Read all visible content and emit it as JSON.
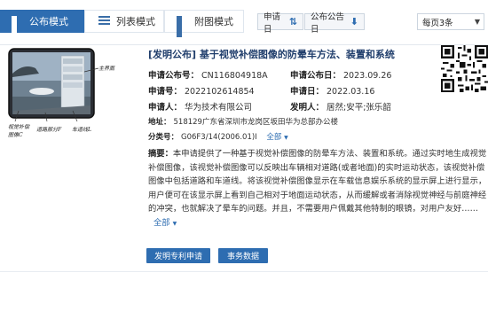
{
  "toolbar": {
    "tabs": [
      {
        "label": "公布模式"
      },
      {
        "label": "列表模式"
      },
      {
        "label": "附图模式"
      }
    ],
    "sort_app_date": "申请日",
    "sort_pub_date": "公布公告日",
    "per_page": "每页3条",
    "colors": {
      "accent": "#2e6db1",
      "title": "#1f3d6b"
    }
  },
  "patent": {
    "title": "[发明公布] 基于视觉补偿图像的防晕车方法、装置和系统",
    "pub_no_label": "申请公布号：",
    "pub_no": "CN116804918A",
    "pub_date_label": "申请公布日：",
    "pub_date": "2023.09.26",
    "app_no_label": "申请号：",
    "app_no": "2022102614854",
    "app_date_label": "申请日：",
    "app_date": "2022.03.16",
    "applicant_label": "申请人：",
    "applicant": "华为技术有限公司",
    "inventor_label": "发明人：",
    "inventor": "居然;安平;张乐韶",
    "address_label": "地址：",
    "address": "518129广东省深圳市龙岗区坂田华为总部办公楼",
    "class_label": "分类号：",
    "class_no": "G06F3/14(2006.01)I",
    "all_label": "全部",
    "abstract_label": "摘要：",
    "abstract": "本申请提供了一种基于视觉补偿图像的防晕车方法、装置和系统。通过实时地生成视觉补偿图像，该视觉补偿图像可以反映出车辆相对道路(或者地面)的实时运动状态，该视觉补偿图像中包括道路和车道线。将该视觉补偿图像显示在车载信息娱乐系统的显示屏上进行显示，用户便可在该显示屏上看到自己相对于地面运动状态，从而缓解或者消除视觉神经与前庭神经的冲突，也就解决了晕车的问题。并且，不需要用户佩戴其他特制的眼镜，对用户友好……",
    "abstract_more": "全部",
    "buttons": {
      "apply": "发明专利申请",
      "affairs": "事务数据"
    }
  },
  "figure": {
    "label_main_screen": "主界面",
    "label_comp_image": "视觉补偿图像C",
    "label_road": "道路部分F",
    "label_lane": "车道线L"
  }
}
